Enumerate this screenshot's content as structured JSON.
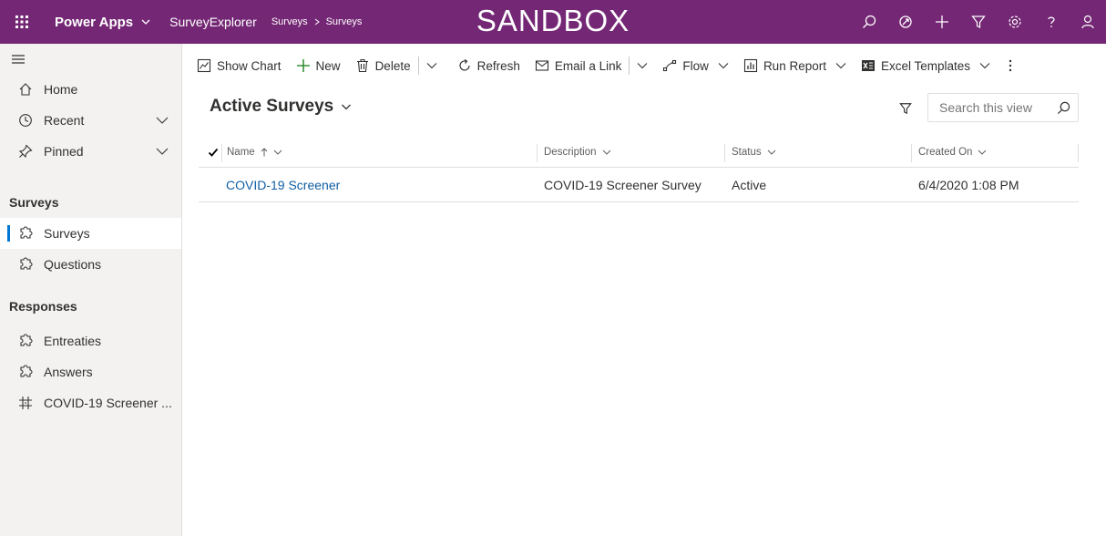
{
  "topbar": {
    "app_name": "Power Apps",
    "app_subtitle": "SurveyExplorer",
    "breadcrumb": [
      "Surveys",
      "Surveys"
    ],
    "environment_label": "SANDBOX",
    "icons": [
      "search-icon",
      "assistant-icon",
      "plus-icon",
      "filter-icon",
      "gear-icon",
      "help-icon",
      "person-icon"
    ],
    "bg_color": "#742774"
  },
  "sidebar": {
    "top_items": [
      {
        "label": "Home",
        "icon": "home-icon"
      },
      {
        "label": "Recent",
        "icon": "clock-icon"
      },
      {
        "label": "Pinned",
        "icon": "pin-icon"
      }
    ],
    "groups": [
      {
        "title": "Surveys",
        "items": [
          {
            "label": "Surveys",
            "icon": "puzzle-icon",
            "selected": true
          },
          {
            "label": "Questions",
            "icon": "puzzle-icon"
          }
        ]
      },
      {
        "title": "Responses",
        "items": [
          {
            "label": "Entreaties",
            "icon": "puzzle-icon"
          },
          {
            "label": "Answers",
            "icon": "puzzle-icon"
          },
          {
            "label": "COVID-19 Screener ...",
            "icon": "grid-entity-icon"
          }
        ]
      }
    ],
    "accent_color": "#0078d4"
  },
  "commandbar": {
    "show_chart": "Show Chart",
    "new": "New",
    "delete": "Delete",
    "refresh": "Refresh",
    "email_link": "Email a Link",
    "flow": "Flow",
    "run_report": "Run Report",
    "excel_templates": "Excel Templates"
  },
  "view": {
    "title": "Active Surveys",
    "search_placeholder": "Search this view",
    "columns": [
      "Name",
      "Description",
      "Status",
      "Created On"
    ],
    "sort": {
      "column": "Name",
      "direction": "ascending"
    },
    "rows": [
      {
        "name": "COVID-19 Screener",
        "description": "COVID-19 Screener Survey",
        "status": "Active",
        "created_on": "6/4/2020 1:08 PM"
      }
    ],
    "link_color": "#115ea3"
  }
}
